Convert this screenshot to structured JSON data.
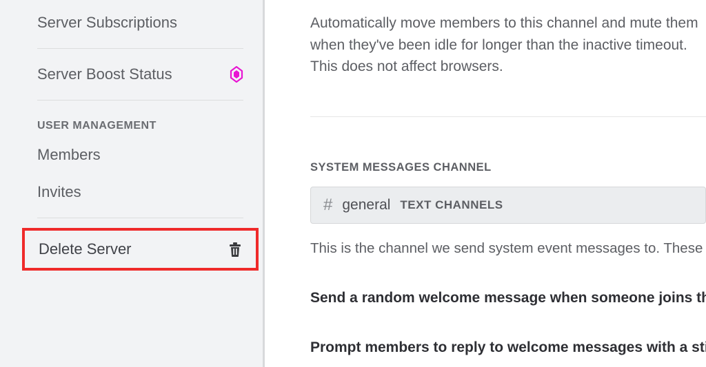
{
  "sidebar": {
    "subscriptions": "Server Subscriptions",
    "boost": "Server Boost Status",
    "user_mgmt_header": "USER MANAGEMENT",
    "members": "Members",
    "invites": "Invites",
    "delete": "Delete Server"
  },
  "main": {
    "afk_desc": "Automatically move members to this channel and mute them when they've been idle for longer than the inactive timeout. This does not affect browsers.",
    "sys_header": "SYSTEM MESSAGES CHANNEL",
    "channel_name": "general",
    "channel_cat": "TEXT CHANNELS",
    "sys_help": "This is the channel we send system event messages to. These settings can be turned off at any time.",
    "welcome_opt": "Send a random welcome message when someone joins this server.",
    "sticker_opt": "Prompt members to reply to welcome messages with a sticker."
  }
}
